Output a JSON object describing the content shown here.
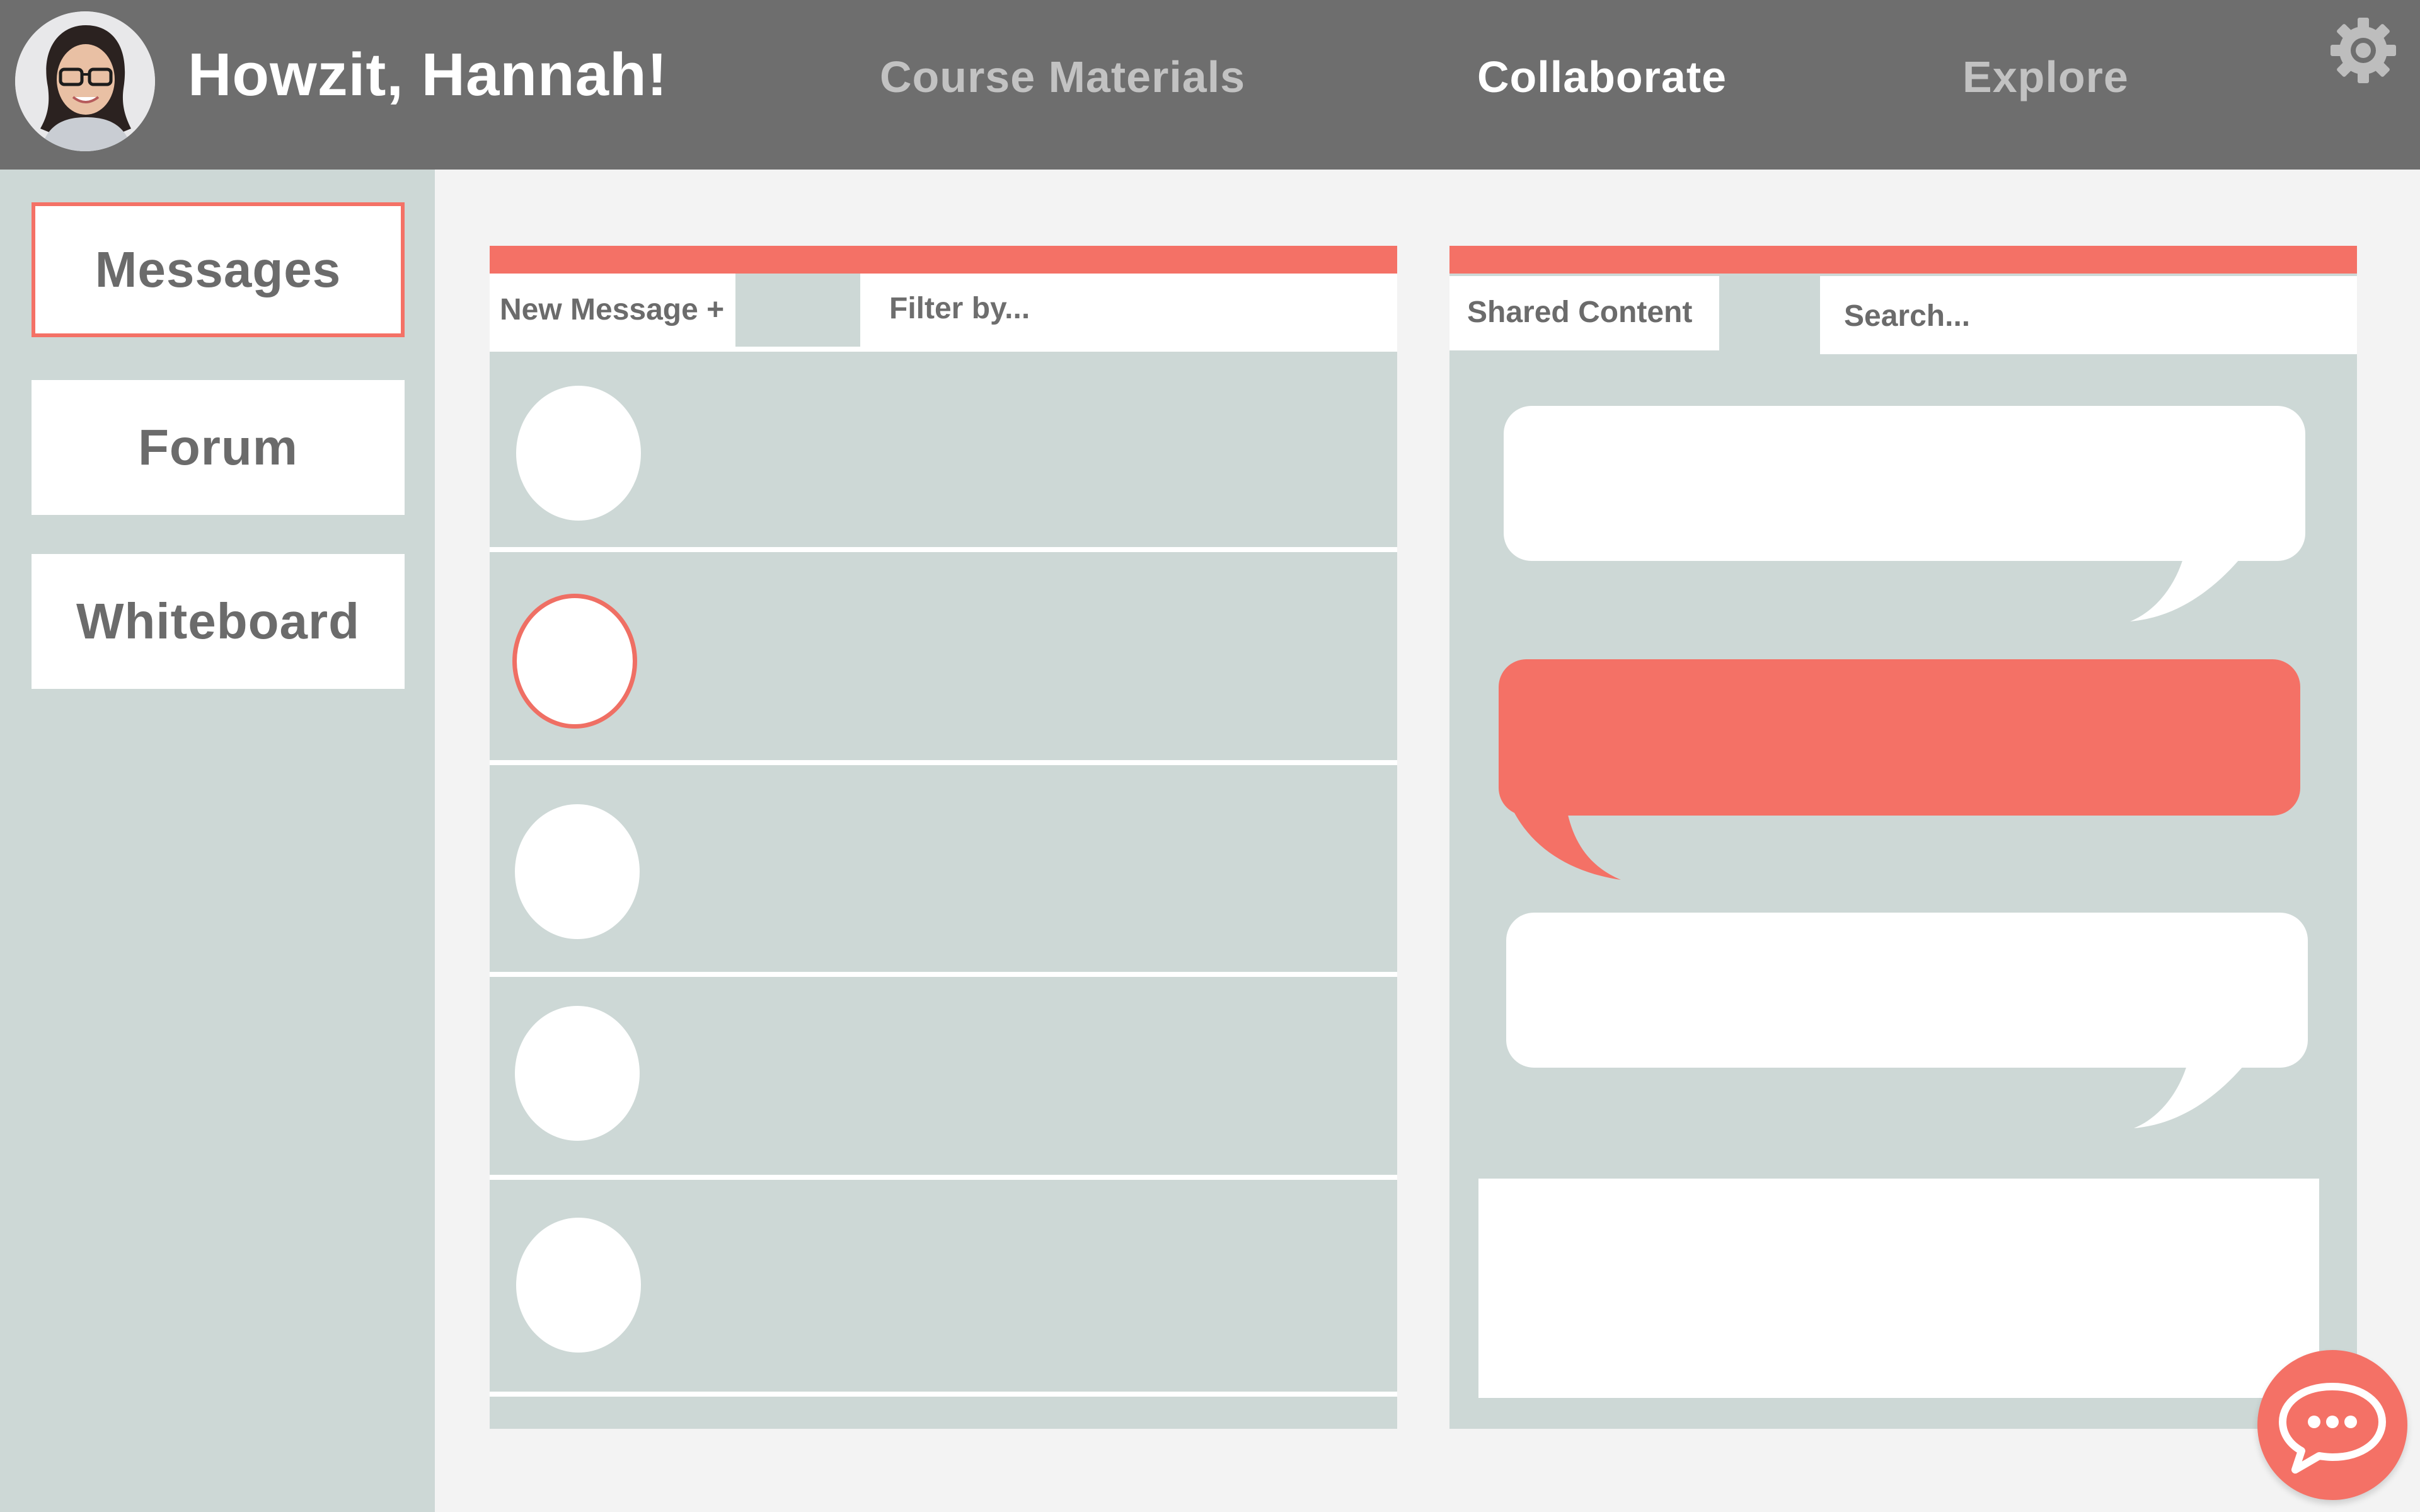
{
  "header": {
    "greeting": "Howzit, Hannah!",
    "nav": [
      {
        "label": "Course Materials",
        "active": false
      },
      {
        "label": "Collaborate",
        "active": true
      },
      {
        "label": "Explore",
        "active": false
      }
    ]
  },
  "sidebar": {
    "items": [
      {
        "label": "Messages",
        "selected": true
      },
      {
        "label": "Forum",
        "selected": false
      },
      {
        "label": "Whiteboard",
        "selected": false
      }
    ]
  },
  "messages_panel": {
    "new_message_label": "New Message +",
    "filter_placeholder": "Filter by..."
  },
  "shared_panel": {
    "tab_label": "Shared Content",
    "search_placeholder": "Search..."
  },
  "icons": {
    "settings": "gear-icon",
    "avatar": "user-avatar",
    "chat": "chat-bubble-icon"
  },
  "colors": {
    "header": "#6e6e6e",
    "accent": "#f47166",
    "panel": "#cdd8d6",
    "background": "#f3f3f3",
    "nav_muted": "#c2c2c2",
    "text": "#6b6b6b"
  }
}
